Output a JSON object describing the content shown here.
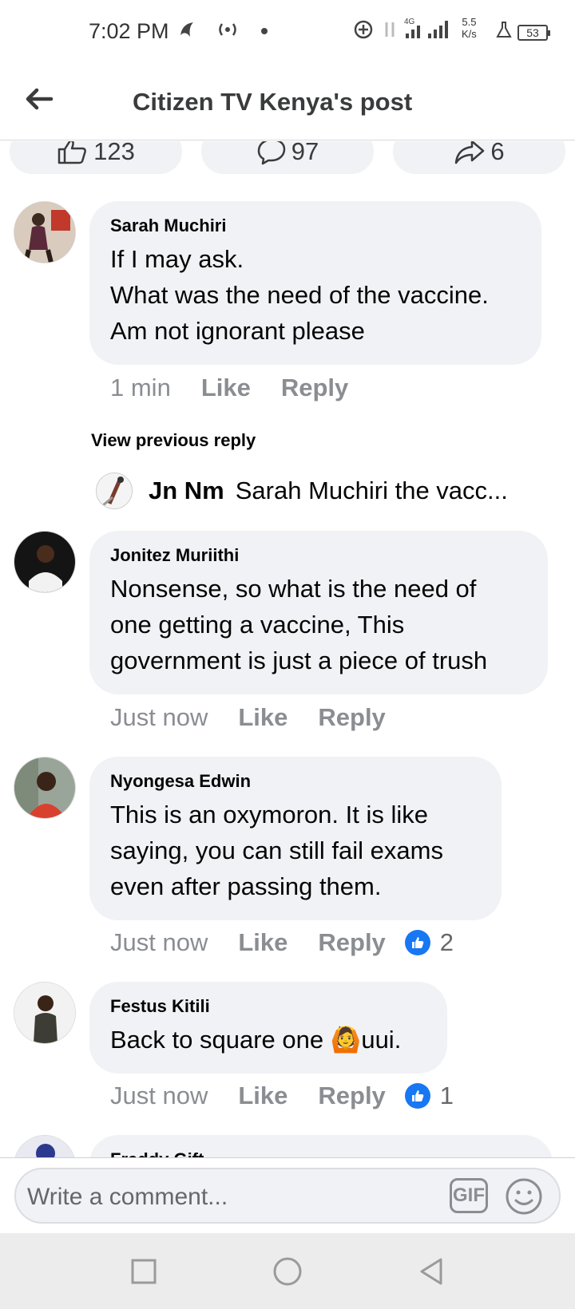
{
  "status_bar": {
    "time": "7:02 PM",
    "network_label": "4G",
    "speed_value": "5.5",
    "speed_unit": "K/s",
    "battery": "53"
  },
  "header": {
    "title": "Citizen TV Kenya's post"
  },
  "post_stats": {
    "likes": "123",
    "comments": "97",
    "shares": "6"
  },
  "comments": [
    {
      "author": "Sarah Muchiri",
      "text": "If I may ask.\nWhat was the need of the vaccine.\nAm not ignorant please",
      "time": "1 min",
      "like_label": "Like",
      "reply_label": "Reply",
      "reactions": ""
    },
    {
      "author": "Jonitez Muriithi",
      "text": "Nonsense, so what is the need of\none getting a vaccine, This\ngovernment is just a piece of trush",
      "time": "Just now",
      "like_label": "Like",
      "reply_label": "Reply",
      "reactions": ""
    },
    {
      "author": "Nyongesa Edwin",
      "text": "This is an oxymoron. It is like\nsaying,  you can still fail exams\neven after passing them.",
      "time": "Just now",
      "like_label": "Like",
      "reply_label": "Reply",
      "reactions": "2"
    },
    {
      "author": "Festus Kitili",
      "text": "Back to square one 🙆uui.",
      "time": "Just now",
      "like_label": "Like",
      "reply_label": "Reply",
      "reactions": "1"
    },
    {
      "author": "Freddy Gift"
    }
  ],
  "view_previous_reply": "View previous reply",
  "reply_preview": {
    "author": "Jn Nm",
    "text": "Sarah Muchiri the vacc..."
  },
  "comment_box": {
    "placeholder": "Write a comment...",
    "gif_label": "GIF"
  },
  "colors": {
    "bubble": "#f0f2f5",
    "like_blue": "#1877f2",
    "meta_grey": "#8a8d91"
  },
  "icons": [
    "back-arrow-icon",
    "thumbs-up-icon",
    "comment-icon",
    "share-icon",
    "like-reaction-icon",
    "gif-icon",
    "emoji-icon",
    "square-nav-icon",
    "circle-nav-icon",
    "triangle-back-nav-icon"
  ]
}
